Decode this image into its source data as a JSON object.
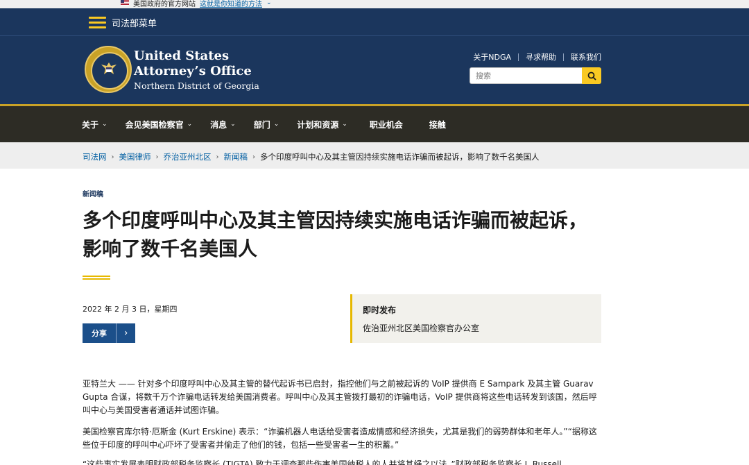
{
  "gov_banner": {
    "text": "美国政府的官方网站",
    "link": "这就是你知道的方法"
  },
  "doj_menu": {
    "label": "司法部菜单"
  },
  "header": {
    "title_line1": "United States",
    "title_line2": "Attorney’s Office",
    "subtitle": "Northern District of Georgia",
    "util_links": [
      "关于NDGA",
      "寻求帮助",
      "联系我们"
    ],
    "search_placeholder": "搜索"
  },
  "nav": {
    "items": [
      {
        "label": "关于",
        "caret": "⌄"
      },
      {
        "label": "会见美国检察官",
        "caret": "⌄"
      },
      {
        "label": "消息",
        "caret": "⌄"
      },
      {
        "label": "部门",
        "caret": "⌄"
      },
      {
        "label": "计划和资源",
        "caret": "⌄"
      },
      {
        "label": "职业机会",
        "caret": ""
      },
      {
        "label": "接触",
        "caret": ""
      }
    ]
  },
  "breadcrumb": {
    "items": [
      "司法网",
      "美国律师",
      "乔治亚州北区",
      "新闻稿"
    ],
    "current": "多个印度呼叫中心及其主管因持续实施电话诈骗而被起诉，影响了数千名美国人"
  },
  "article": {
    "type": "新闻稿",
    "headline": "多个印度呼叫中心及其主管因持续实施电话诈骗而被起诉，影响了数千名美国人",
    "date": "2022 年 2 月 3 日，星期四",
    "share_label": "分享",
    "release_title": "即时发布",
    "release_source": "佐治亚州北区美国检察官办公室",
    "paragraphs": [
      "亚特兰大 —— 针对多个印度呼叫中心及其主管的替代起诉书已启封，指控他们与之前被起诉的 VoIP 提供商 E Sampark 及其主管 Guarav Gupta 合谋，将数千万个诈骗电话转发给美国消费者。呼叫中心及其主管拨打最初的诈骗电话，VoIP 提供商将这些电话转发到该国，然后呼叫中心与美国受害者通话并试图诈骗。",
      "美国检察官库尔特·厄斯金 (Kurt Erskine) 表示：“诈骗机器人电话给受害者造成情感和经济损失，尤其是我们的弱势群体和老年人。”“据称这些位于印度的呼叫中心吓坏了受害者并偷走了他们的钱，包括一些受害者一生的积蓄。”",
      "“这些事实发展表明财政部税务监察长 (TIGTA) 致力于调查那些伤害美国纳税人的人并将其绳之以法，”财政部税务监察长 J. Russell"
    ]
  }
}
